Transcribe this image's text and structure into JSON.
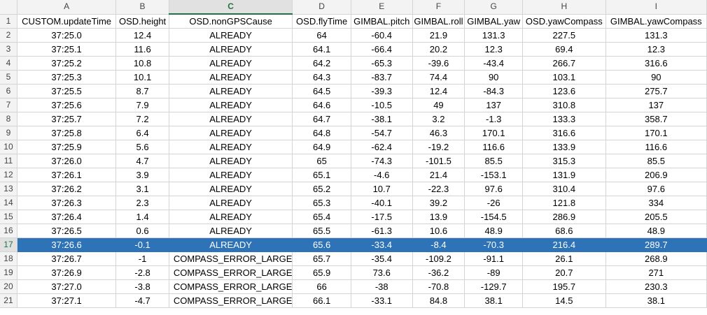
{
  "columns": [
    {
      "letter": "A"
    },
    {
      "letter": "B"
    },
    {
      "letter": "C"
    },
    {
      "letter": "D"
    },
    {
      "letter": "E"
    },
    {
      "letter": "F"
    },
    {
      "letter": "G"
    },
    {
      "letter": "H"
    },
    {
      "letter": "I"
    }
  ],
  "selected_column": "C",
  "selected_row": "17",
  "rows": [
    {
      "num": "1",
      "cells": [
        "CUSTOM.updateTime",
        "OSD.height",
        "OSD.nonGPSCause",
        "OSD.flyTime",
        "GIMBAL.pitch",
        "GIMBAL.roll",
        "GIMBAL.yaw",
        "OSD.yawCompass",
        "GIMBAL.yawCompass"
      ]
    },
    {
      "num": "2",
      "cells": [
        "37:25.0",
        "12.4",
        "ALREADY",
        "64",
        "-60.4",
        "21.9",
        "131.3",
        "227.5",
        "131.3"
      ]
    },
    {
      "num": "3",
      "cells": [
        "37:25.1",
        "11.6",
        "ALREADY",
        "64.1",
        "-66.4",
        "20.2",
        "12.3",
        "69.4",
        "12.3"
      ]
    },
    {
      "num": "4",
      "cells": [
        "37:25.2",
        "10.8",
        "ALREADY",
        "64.2",
        "-65.3",
        "-39.6",
        "-43.4",
        "266.7",
        "316.6"
      ]
    },
    {
      "num": "5",
      "cells": [
        "37:25.3",
        "10.1",
        "ALREADY",
        "64.3",
        "-83.7",
        "74.4",
        "90",
        "103.1",
        "90"
      ]
    },
    {
      "num": "6",
      "cells": [
        "37:25.5",
        "8.7",
        "ALREADY",
        "64.5",
        "-39.3",
        "12.4",
        "-84.3",
        "123.6",
        "275.7"
      ]
    },
    {
      "num": "7",
      "cells": [
        "37:25.6",
        "7.9",
        "ALREADY",
        "64.6",
        "-10.5",
        "49",
        "137",
        "310.8",
        "137"
      ]
    },
    {
      "num": "8",
      "cells": [
        "37:25.7",
        "7.2",
        "ALREADY",
        "64.7",
        "-38.1",
        "3.2",
        "-1.3",
        "133.3",
        "358.7"
      ]
    },
    {
      "num": "9",
      "cells": [
        "37:25.8",
        "6.4",
        "ALREADY",
        "64.8",
        "-54.7",
        "46.3",
        "170.1",
        "316.6",
        "170.1"
      ]
    },
    {
      "num": "10",
      "cells": [
        "37:25.9",
        "5.6",
        "ALREADY",
        "64.9",
        "-62.4",
        "-19.2",
        "116.6",
        "133.9",
        "116.6"
      ]
    },
    {
      "num": "11",
      "cells": [
        "37:26.0",
        "4.7",
        "ALREADY",
        "65",
        "-74.3",
        "-101.5",
        "85.5",
        "315.3",
        "85.5"
      ]
    },
    {
      "num": "12",
      "cells": [
        "37:26.1",
        "3.9",
        "ALREADY",
        "65.1",
        "-4.6",
        "21.4",
        "-153.1",
        "131.9",
        "206.9"
      ]
    },
    {
      "num": "13",
      "cells": [
        "37:26.2",
        "3.1",
        "ALREADY",
        "65.2",
        "10.7",
        "-22.3",
        "97.6",
        "310.4",
        "97.6"
      ]
    },
    {
      "num": "14",
      "cells": [
        "37:26.3",
        "2.3",
        "ALREADY",
        "65.3",
        "-40.1",
        "39.2",
        "-26",
        "121.8",
        "334"
      ]
    },
    {
      "num": "15",
      "cells": [
        "37:26.4",
        "1.4",
        "ALREADY",
        "65.4",
        "-17.5",
        "13.9",
        "-154.5",
        "286.9",
        "205.5"
      ]
    },
    {
      "num": "16",
      "cells": [
        "37:26.5",
        "0.6",
        "ALREADY",
        "65.5",
        "-61.3",
        "10.6",
        "48.9",
        "68.6",
        "48.9"
      ]
    },
    {
      "num": "17",
      "cells": [
        "37:26.6",
        "-0.1",
        "ALREADY",
        "65.6",
        "-33.4",
        "-8.4",
        "-70.3",
        "216.4",
        "289.7"
      ]
    },
    {
      "num": "18",
      "cells": [
        "37:26.7",
        "-1",
        "COMPASS_ERROR_LARGE",
        "65.7",
        "-35.4",
        "-109.2",
        "-91.1",
        "26.1",
        "268.9"
      ]
    },
    {
      "num": "19",
      "cells": [
        "37:26.9",
        "-2.8",
        "COMPASS_ERROR_LARGE",
        "65.9",
        "73.6",
        "-36.2",
        "-89",
        "20.7",
        "271"
      ]
    },
    {
      "num": "20",
      "cells": [
        "37:27.0",
        "-3.8",
        "COMPASS_ERROR_LARGE",
        "66",
        "-38",
        "-70.8",
        "-129.7",
        "195.7",
        "230.3"
      ]
    },
    {
      "num": "21",
      "cells": [
        "37:27.1",
        "-4.7",
        "COMPASS_ERROR_LARGE",
        "66.1",
        "-33.1",
        "84.8",
        "38.1",
        "14.5",
        "38.1"
      ]
    }
  ],
  "colors": {
    "selection": "#2e73b7",
    "accent": "#217346"
  }
}
